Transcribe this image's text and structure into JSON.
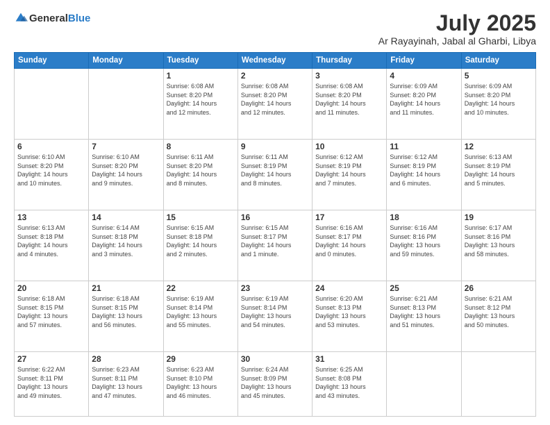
{
  "header": {
    "logo_line1": "General",
    "logo_line2": "Blue",
    "month_title": "July 2025",
    "location": "Ar Rayayinah, Jabal al Gharbi, Libya"
  },
  "days_of_week": [
    "Sunday",
    "Monday",
    "Tuesday",
    "Wednesday",
    "Thursday",
    "Friday",
    "Saturday"
  ],
  "weeks": [
    [
      {
        "day": "",
        "info": ""
      },
      {
        "day": "",
        "info": ""
      },
      {
        "day": "1",
        "info": "Sunrise: 6:08 AM\nSunset: 8:20 PM\nDaylight: 14 hours\nand 12 minutes."
      },
      {
        "day": "2",
        "info": "Sunrise: 6:08 AM\nSunset: 8:20 PM\nDaylight: 14 hours\nand 12 minutes."
      },
      {
        "day": "3",
        "info": "Sunrise: 6:08 AM\nSunset: 8:20 PM\nDaylight: 14 hours\nand 11 minutes."
      },
      {
        "day": "4",
        "info": "Sunrise: 6:09 AM\nSunset: 8:20 PM\nDaylight: 14 hours\nand 11 minutes."
      },
      {
        "day": "5",
        "info": "Sunrise: 6:09 AM\nSunset: 8:20 PM\nDaylight: 14 hours\nand 10 minutes."
      }
    ],
    [
      {
        "day": "6",
        "info": "Sunrise: 6:10 AM\nSunset: 8:20 PM\nDaylight: 14 hours\nand 10 minutes."
      },
      {
        "day": "7",
        "info": "Sunrise: 6:10 AM\nSunset: 8:20 PM\nDaylight: 14 hours\nand 9 minutes."
      },
      {
        "day": "8",
        "info": "Sunrise: 6:11 AM\nSunset: 8:20 PM\nDaylight: 14 hours\nand 8 minutes."
      },
      {
        "day": "9",
        "info": "Sunrise: 6:11 AM\nSunset: 8:19 PM\nDaylight: 14 hours\nand 8 minutes."
      },
      {
        "day": "10",
        "info": "Sunrise: 6:12 AM\nSunset: 8:19 PM\nDaylight: 14 hours\nand 7 minutes."
      },
      {
        "day": "11",
        "info": "Sunrise: 6:12 AM\nSunset: 8:19 PM\nDaylight: 14 hours\nand 6 minutes."
      },
      {
        "day": "12",
        "info": "Sunrise: 6:13 AM\nSunset: 8:19 PM\nDaylight: 14 hours\nand 5 minutes."
      }
    ],
    [
      {
        "day": "13",
        "info": "Sunrise: 6:13 AM\nSunset: 8:18 PM\nDaylight: 14 hours\nand 4 minutes."
      },
      {
        "day": "14",
        "info": "Sunrise: 6:14 AM\nSunset: 8:18 PM\nDaylight: 14 hours\nand 3 minutes."
      },
      {
        "day": "15",
        "info": "Sunrise: 6:15 AM\nSunset: 8:18 PM\nDaylight: 14 hours\nand 2 minutes."
      },
      {
        "day": "16",
        "info": "Sunrise: 6:15 AM\nSunset: 8:17 PM\nDaylight: 14 hours\nand 1 minute."
      },
      {
        "day": "17",
        "info": "Sunrise: 6:16 AM\nSunset: 8:17 PM\nDaylight: 14 hours\nand 0 minutes."
      },
      {
        "day": "18",
        "info": "Sunrise: 6:16 AM\nSunset: 8:16 PM\nDaylight: 13 hours\nand 59 minutes."
      },
      {
        "day": "19",
        "info": "Sunrise: 6:17 AM\nSunset: 8:16 PM\nDaylight: 13 hours\nand 58 minutes."
      }
    ],
    [
      {
        "day": "20",
        "info": "Sunrise: 6:18 AM\nSunset: 8:15 PM\nDaylight: 13 hours\nand 57 minutes."
      },
      {
        "day": "21",
        "info": "Sunrise: 6:18 AM\nSunset: 8:15 PM\nDaylight: 13 hours\nand 56 minutes."
      },
      {
        "day": "22",
        "info": "Sunrise: 6:19 AM\nSunset: 8:14 PM\nDaylight: 13 hours\nand 55 minutes."
      },
      {
        "day": "23",
        "info": "Sunrise: 6:19 AM\nSunset: 8:14 PM\nDaylight: 13 hours\nand 54 minutes."
      },
      {
        "day": "24",
        "info": "Sunrise: 6:20 AM\nSunset: 8:13 PM\nDaylight: 13 hours\nand 53 minutes."
      },
      {
        "day": "25",
        "info": "Sunrise: 6:21 AM\nSunset: 8:13 PM\nDaylight: 13 hours\nand 51 minutes."
      },
      {
        "day": "26",
        "info": "Sunrise: 6:21 AM\nSunset: 8:12 PM\nDaylight: 13 hours\nand 50 minutes."
      }
    ],
    [
      {
        "day": "27",
        "info": "Sunrise: 6:22 AM\nSunset: 8:11 PM\nDaylight: 13 hours\nand 49 minutes."
      },
      {
        "day": "28",
        "info": "Sunrise: 6:23 AM\nSunset: 8:11 PM\nDaylight: 13 hours\nand 47 minutes."
      },
      {
        "day": "29",
        "info": "Sunrise: 6:23 AM\nSunset: 8:10 PM\nDaylight: 13 hours\nand 46 minutes."
      },
      {
        "day": "30",
        "info": "Sunrise: 6:24 AM\nSunset: 8:09 PM\nDaylight: 13 hours\nand 45 minutes."
      },
      {
        "day": "31",
        "info": "Sunrise: 6:25 AM\nSunset: 8:08 PM\nDaylight: 13 hours\nand 43 minutes."
      },
      {
        "day": "",
        "info": ""
      },
      {
        "day": "",
        "info": ""
      }
    ]
  ]
}
